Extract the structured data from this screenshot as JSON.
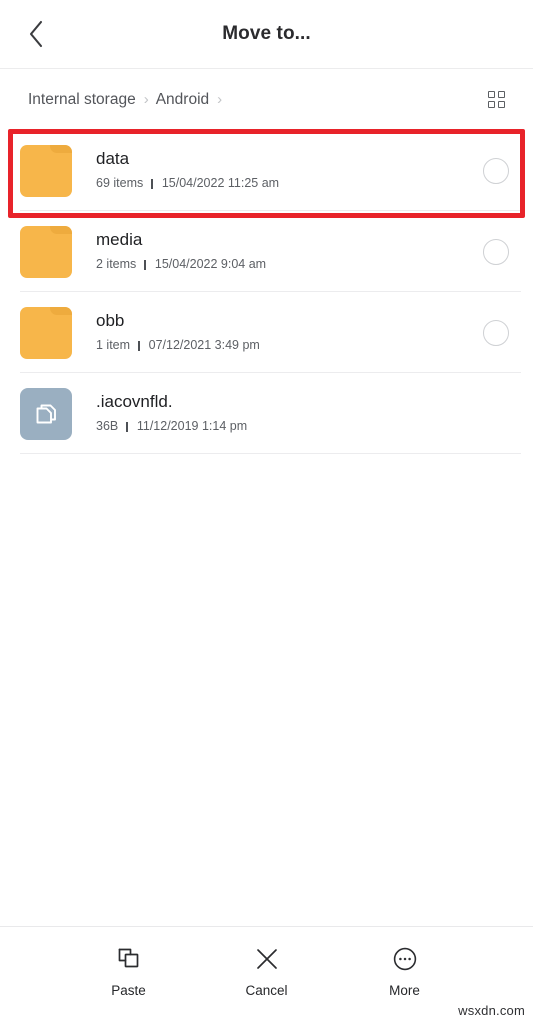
{
  "header": {
    "title": "Move to...",
    "back_icon": "chevron-left-icon"
  },
  "breadcrumb": {
    "separator": "›",
    "items": [
      {
        "label": "Internal storage"
      },
      {
        "label": "Android"
      }
    ],
    "view_toggle_icon": "grid-view-icon"
  },
  "file_list": {
    "meta_separator": "|",
    "items": [
      {
        "name": "data",
        "kind": "folder",
        "icon": "folder-icon",
        "count": "69 items",
        "date": "15/04/2022 11:25 am",
        "selectable": true,
        "selected": false,
        "highlighted": true
      },
      {
        "name": "media",
        "kind": "folder",
        "icon": "folder-icon",
        "count": "2 items",
        "date": "15/04/2022 9:04 am",
        "selectable": true,
        "selected": false,
        "highlighted": false
      },
      {
        "name": "obb",
        "kind": "folder",
        "icon": "folder-icon",
        "count": "1 item",
        "date": "07/12/2021 3:49 pm",
        "selectable": true,
        "selected": false,
        "highlighted": false
      },
      {
        "name": ".iacovnfld.",
        "kind": "file",
        "icon": "document-copy-icon",
        "count": "36B",
        "date": "11/12/2019 1:14 pm",
        "selectable": false,
        "selected": false,
        "highlighted": false
      }
    ]
  },
  "bottom_bar": {
    "actions": [
      {
        "label": "Paste",
        "icon": "paste-icon"
      },
      {
        "label": "Cancel",
        "icon": "close-x-icon"
      },
      {
        "label": "More",
        "icon": "more-circle-icon"
      }
    ]
  },
  "watermark": {
    "text": "wsxdn.com"
  },
  "colors": {
    "folder": "#f7b64a",
    "file_tile": "#9aafc1",
    "highlight": "#e8232a",
    "text_primary": "#1f2023",
    "text_secondary": "#5d6065",
    "divider": "#ececee"
  }
}
